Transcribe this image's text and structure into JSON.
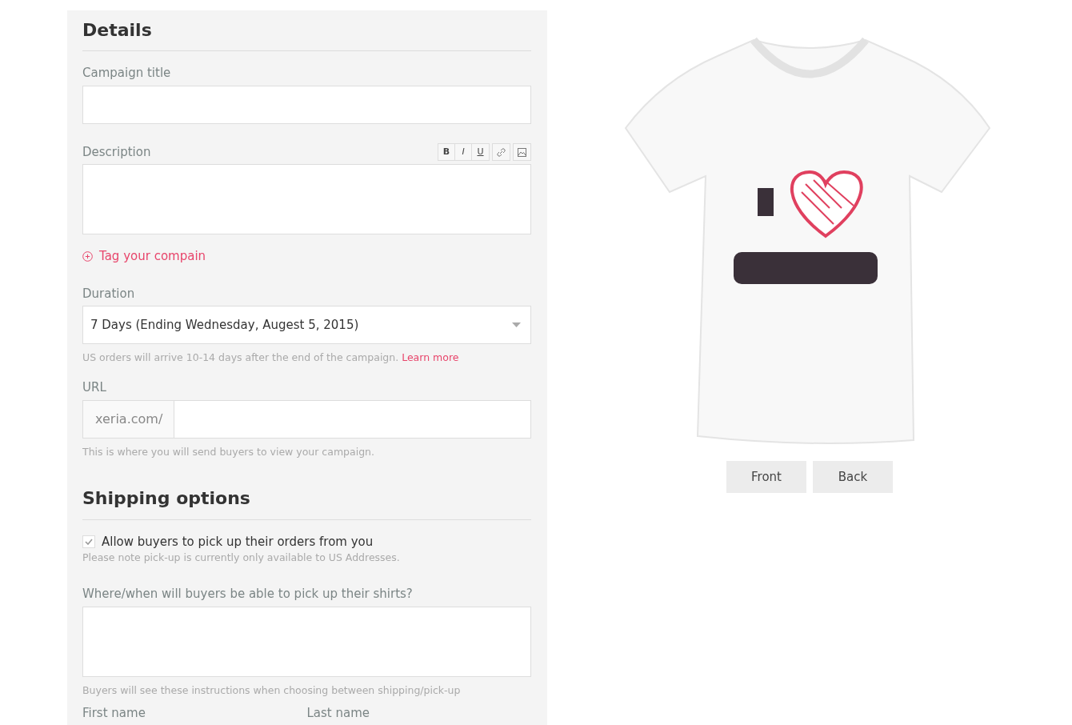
{
  "details": {
    "heading": "Details",
    "campaign_title": {
      "label": "Campaign title"
    },
    "description": {
      "label": "Description",
      "format_buttons": [
        "B",
        "I",
        "U"
      ]
    },
    "tag_link": "Tag your compain",
    "duration": {
      "label": "Duration",
      "value": "7 Days (Ending Wednesday, Augest 5, 2015)",
      "note": "US orders will arrive 10-14 days after the end of the campaign.",
      "note_link": "Learn more"
    },
    "url": {
      "label": "URL",
      "prefix": "xeria.com/",
      "note": "This is where you will send buyers to view your campaign."
    }
  },
  "shipping": {
    "heading": "Shipping options",
    "pickup": {
      "label": "Allow buyers to pick up their orders from you",
      "checked": true,
      "note": "Please note pick-up is currently only available to US Addresses."
    },
    "instructions": {
      "label": "Where/when will buyers be able to pick up their shirts?",
      "note": "Buyers will see these instructions when choosing between shipping/pick-up"
    },
    "name_fields": [
      "First name",
      "Last name"
    ]
  },
  "preview": {
    "views": [
      "Front",
      "Back"
    ]
  }
}
